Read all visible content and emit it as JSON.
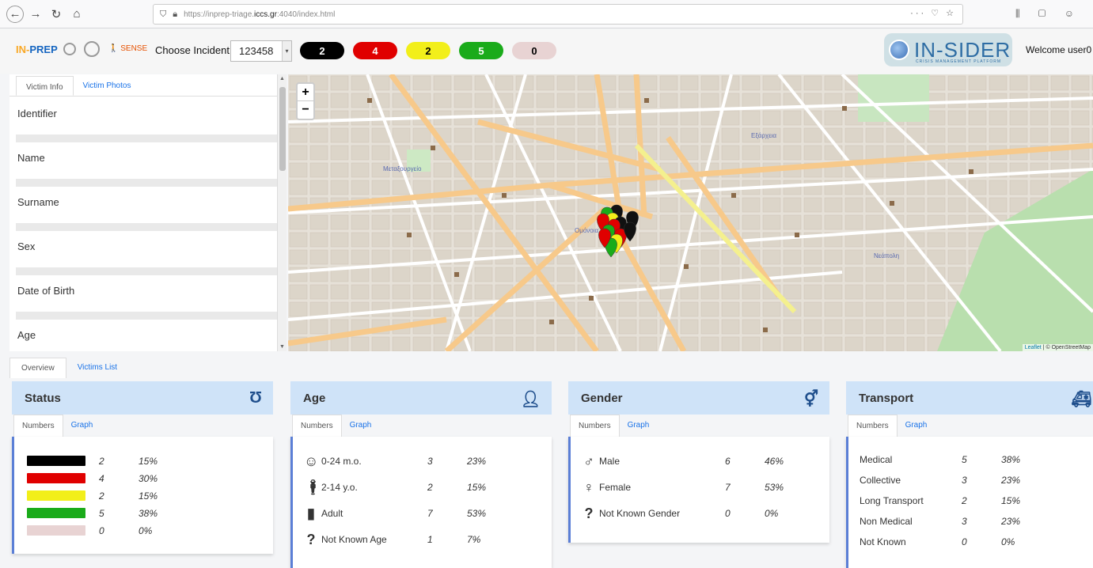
{
  "browser": {
    "url_prefix": "https://inprep-triage.",
    "url_domain": "iccs.gr",
    "url_suffix": ":4040/index.html"
  },
  "header": {
    "logo_in": "IN-",
    "logo_prep": "PREP",
    "sense_logo": "SENSE",
    "incident_label": "Choose Incident:",
    "incident_value": "123458",
    "counts": [
      {
        "value": "2",
        "color": "#000000",
        "text_color": "#ffffff"
      },
      {
        "value": "4",
        "color": "#e00000",
        "text_color": "#ffffff"
      },
      {
        "value": "2",
        "color": "#f2ef1a",
        "text_color": "#000000"
      },
      {
        "value": "5",
        "color": "#1aab1a",
        "text_color": "#ffffff"
      },
      {
        "value": "0",
        "color": "#e8d3d3",
        "text_color": "#000000"
      }
    ],
    "brand": "IN-SIDER",
    "brand_sub": "CRISIS MANAGEMENT PLATFORM",
    "welcome": "Welcome user0"
  },
  "victim_panel": {
    "tabs": [
      "Victim Info",
      "Victim Photos"
    ],
    "fields": [
      "Identifier",
      "Name",
      "Surname",
      "Sex",
      "Date of Birth",
      "Age"
    ]
  },
  "map": {
    "zoom_in": "+",
    "zoom_out": "−",
    "attribution_leaflet": "Leaflet",
    "attribution_osm": "| © OpenStreetMap",
    "labels": [
      "Μεταξουργείο",
      "Ομόνοια",
      "Εξάρχεια",
      "Νεάπολη"
    ]
  },
  "bottom_tabs": [
    "Overview",
    "Victims List"
  ],
  "cards": {
    "status": {
      "title": "Status",
      "icon": "stethoscope-icon",
      "tabs": [
        "Numbers",
        "Graph"
      ],
      "rows": [
        {
          "color": "#000000",
          "num": "2",
          "pct": "15%"
        },
        {
          "color": "#e00000",
          "num": "4",
          "pct": "30%"
        },
        {
          "color": "#f2ef1a",
          "num": "2",
          "pct": "15%"
        },
        {
          "color": "#1aab1a",
          "num": "5",
          "pct": "38%"
        },
        {
          "color": "#e8d3d3",
          "num": "0",
          "pct": "0%"
        }
      ]
    },
    "age": {
      "title": "Age",
      "icon": "user-clock-icon",
      "tabs": [
        "Numbers",
        "Graph"
      ],
      "rows": [
        {
          "label": "0-24 m.o.",
          "num": "3",
          "pct": "23%"
        },
        {
          "label": "2-14 y.o.",
          "num": "2",
          "pct": "15%"
        },
        {
          "label": "Adult",
          "num": "7",
          "pct": "53%"
        },
        {
          "label": "Not Known Age",
          "num": "1",
          "pct": "7%"
        }
      ]
    },
    "gender": {
      "title": "Gender",
      "icon": "gender-icon",
      "tabs": [
        "Numbers",
        "Graph"
      ],
      "rows": [
        {
          "label": "Male",
          "num": "6",
          "pct": "46%"
        },
        {
          "label": "Female",
          "num": "7",
          "pct": "53%"
        },
        {
          "label": "Not Known Gender",
          "num": "0",
          "pct": "0%"
        }
      ]
    },
    "transport": {
      "title": "Transport",
      "icon": "ambulance-icon",
      "tabs": [
        "Numbers",
        "Graph"
      ],
      "rows": [
        {
          "label": "Medical",
          "num": "5",
          "pct": "38%"
        },
        {
          "label": "Collective",
          "num": "3",
          "pct": "23%"
        },
        {
          "label": "Long Transport",
          "num": "2",
          "pct": "15%"
        },
        {
          "label": "Non Medical",
          "num": "3",
          "pct": "23%"
        },
        {
          "label": "Not Known",
          "num": "0",
          "pct": "0%"
        }
      ]
    }
  }
}
